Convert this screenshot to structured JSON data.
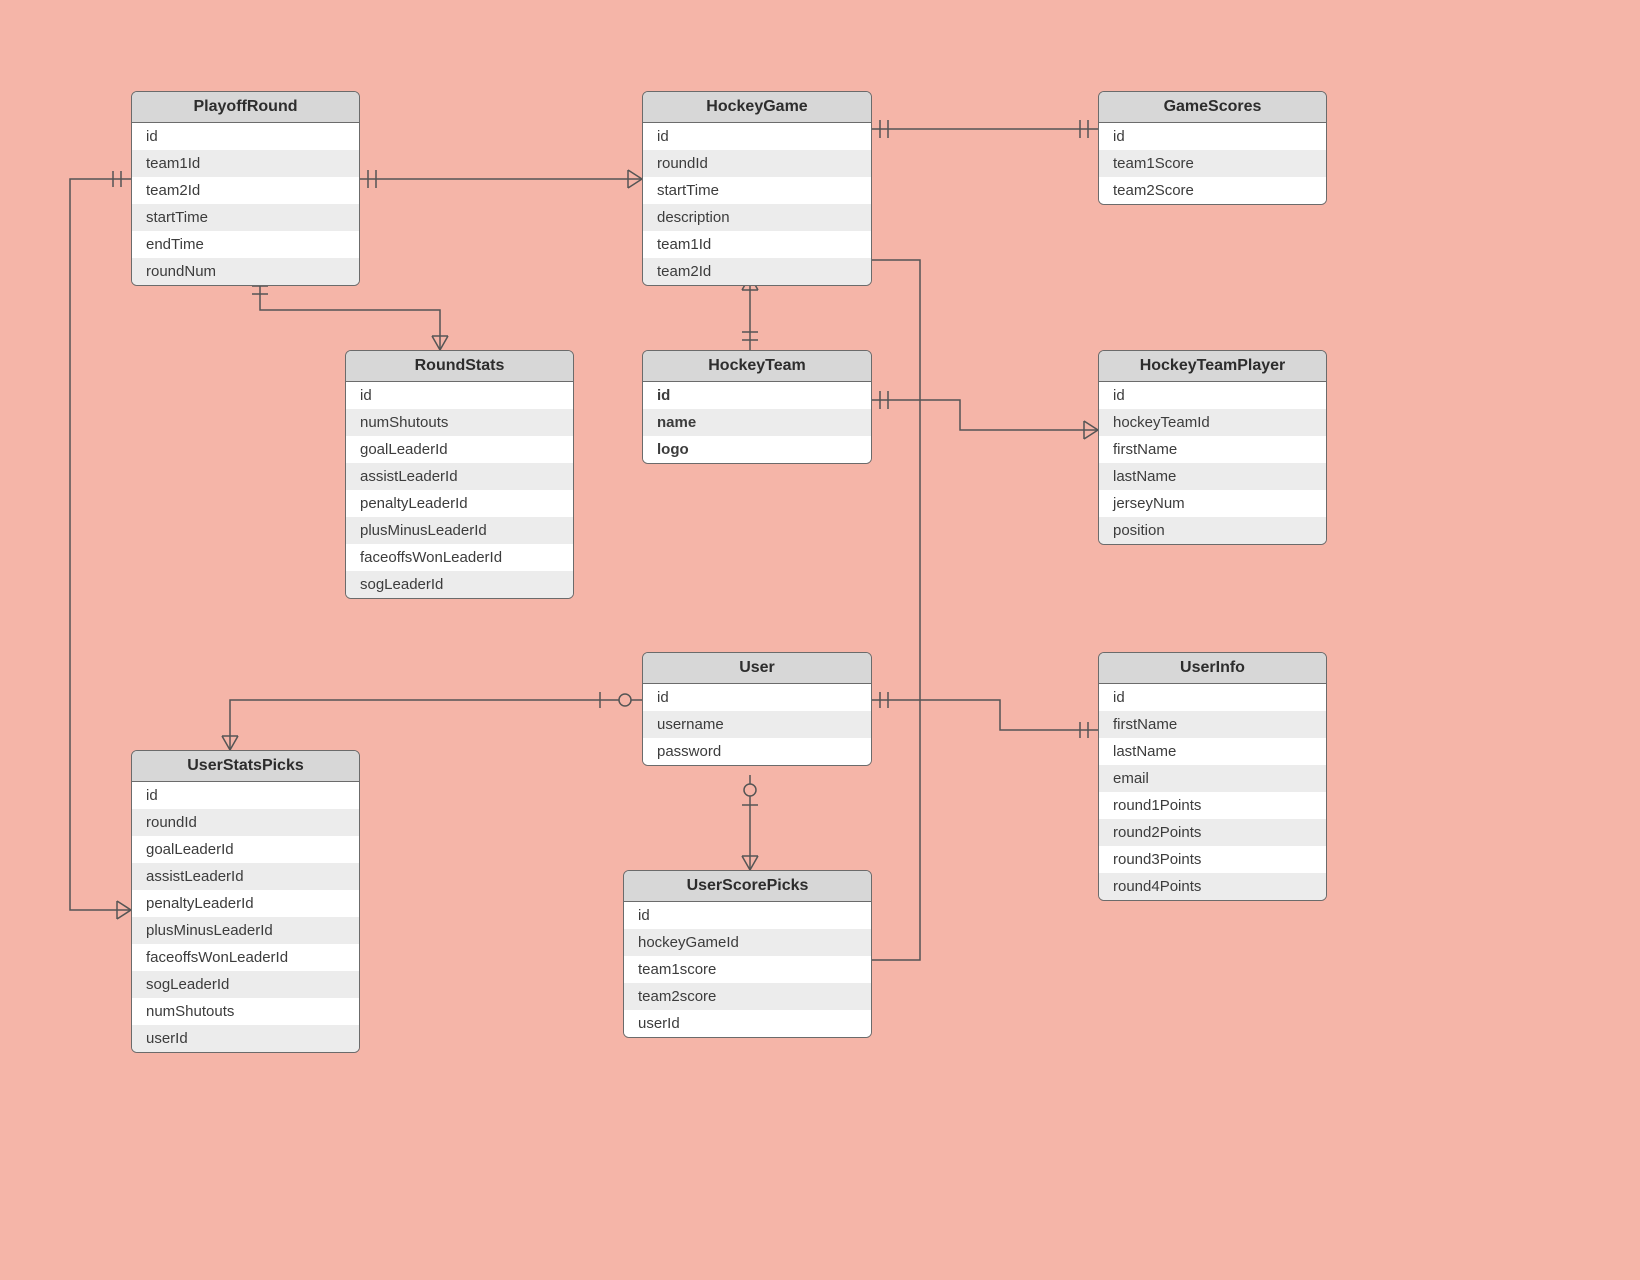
{
  "entities": {
    "playoffRound": {
      "title": "PlayoffRound",
      "fields": [
        "id",
        "team1Id",
        "team2Id",
        "startTime",
        "endTime",
        "roundNum"
      ],
      "bold": []
    },
    "hockeyGame": {
      "title": "HockeyGame",
      "fields": [
        "id",
        "roundId",
        "startTime",
        "description",
        "team1Id",
        "team2Id"
      ],
      "bold": []
    },
    "gameScores": {
      "title": "GameScores",
      "fields": [
        "id",
        "team1Score",
        "team2Score"
      ],
      "bold": []
    },
    "roundStats": {
      "title": "RoundStats",
      "fields": [
        "id",
        "numShutouts",
        "goalLeaderId",
        "assistLeaderId",
        "penaltyLeaderId",
        "plusMinusLeaderId",
        "faceoffsWonLeaderId",
        "sogLeaderId"
      ],
      "bold": []
    },
    "hockeyTeam": {
      "title": "HockeyTeam",
      "fields": [
        "id",
        "name",
        "logo"
      ],
      "bold": [
        "id",
        "name",
        "logo"
      ]
    },
    "hockeyTeamPlayer": {
      "title": "HockeyTeamPlayer",
      "fields": [
        "id",
        "hockeyTeamId",
        "firstName",
        "lastName",
        "jerseyNum",
        "position"
      ],
      "bold": []
    },
    "user": {
      "title": "User",
      "fields": [
        "id",
        "username",
        "password"
      ],
      "bold": []
    },
    "userInfo": {
      "title": "UserInfo",
      "fields": [
        "id",
        "firstName",
        "lastName",
        "email",
        "round1Points",
        "round2Points",
        "round3Points",
        "round4Points"
      ],
      "bold": []
    },
    "userStatsPicks": {
      "title": "UserStatsPicks",
      "fields": [
        "id",
        "roundId",
        "goalLeaderId",
        "assistLeaderId",
        "penaltyLeaderId",
        "plusMinusLeaderId",
        "faceoffsWonLeaderId",
        "sogLeaderId",
        "numShutouts",
        "userId"
      ],
      "bold": []
    },
    "userScorePicks": {
      "title": "UserScorePicks",
      "fields": [
        "id",
        "hockeyGameId",
        "team1score",
        "team2score",
        "userId"
      ],
      "bold": []
    }
  }
}
